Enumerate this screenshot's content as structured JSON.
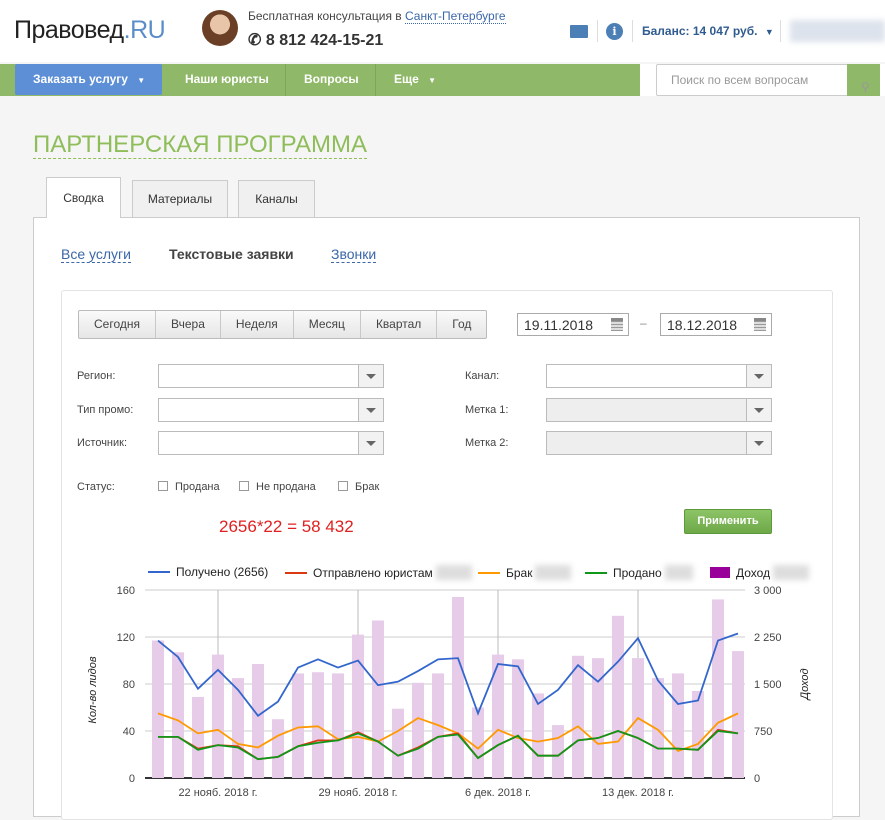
{
  "header": {
    "logo_main": "Правовед",
    "logo_suffix": ".RU",
    "consult_text": "Бесплатная консультация в ",
    "city": "Санкт-Петербурге",
    "phone": "8 812 424-15-21",
    "balance": "Баланс: 14 047 руб.",
    "info": "i"
  },
  "nav": {
    "order": "Заказать услугу",
    "items": [
      "Наши юристы",
      "Вопросы",
      "Еще"
    ],
    "search_placeholder": "Поиск по всем вопросам"
  },
  "page": {
    "title": "ПАРТНЕРСКАЯ ПРОГРАММА",
    "tabs": [
      "Сводка",
      "Материалы",
      "Каналы"
    ],
    "subtabs": [
      "Все услуги",
      "Текстовые заявки",
      "Звонки"
    ]
  },
  "filters": {
    "periods": [
      "Сегодня",
      "Вчера",
      "Неделя",
      "Месяц",
      "Квартал",
      "Год"
    ],
    "date_from": "19.11.2018",
    "date_to": "18.12.2018",
    "dash": "–",
    "labels": {
      "region": "Регион:",
      "promo": "Тип промо:",
      "source": "Источник:",
      "channel": "Канал:",
      "tag1": "Метка 1:",
      "tag2": "Метка 2:",
      "status": "Статус:"
    },
    "statuses": [
      "Продана",
      "Не продана",
      "Брак"
    ],
    "apply": "Применить"
  },
  "formula": "2656*22 = 58 432",
  "chart_data": {
    "type": "line+bar",
    "legend": [
      "Получено (2656)",
      "Отправлено юристам",
      "Брак",
      "Продано",
      "Доход"
    ],
    "colors": {
      "received": "#3366cc",
      "sent": "#dc3912",
      "defect": "#ff9900",
      "sold": "#109618",
      "revenue": "#e6cce8",
      "revenue_legend": "#990099"
    },
    "ylabel": "Кол-во лидов",
    "y2label": "Доход",
    "ylim": [
      0,
      160
    ],
    "y2lim": [
      0,
      3000
    ],
    "yticks": [
      "0",
      "40",
      "80",
      "120",
      "160"
    ],
    "y2ticks": [
      "0",
      "750",
      "1 500",
      "2 250",
      "3 000"
    ],
    "xticks": [
      "22 нояб. 2018 г.",
      "29 нояб. 2018 г.",
      "6 дек. 2018 г.",
      "13 дек. 2018 г."
    ],
    "xtick_index": [
      3,
      10,
      17,
      24
    ],
    "received": [
      117,
      103,
      76,
      92,
      75,
      53,
      65,
      94,
      101,
      94,
      100,
      79,
      82,
      91,
      101,
      102,
      55,
      97,
      95,
      63,
      75,
      96,
      82,
      99,
      119,
      83,
      63,
      66,
      117,
      123
    ],
    "sent": [
      35,
      35,
      25,
      28,
      27,
      16,
      18,
      27,
      32,
      32,
      39,
      31,
      19,
      26,
      35,
      38,
      17,
      28,
      36,
      19,
      19,
      32,
      34,
      40,
      34,
      25,
      25,
      24,
      41,
      38
    ],
    "defect": [
      55,
      49,
      38,
      41,
      29,
      26,
      36,
      43,
      44,
      33,
      35,
      31,
      40,
      51,
      45,
      38,
      25,
      41,
      34,
      31,
      34,
      44,
      29,
      31,
      51,
      41,
      23,
      29,
      47,
      55
    ],
    "sold": [
      35,
      35,
      24,
      28,
      26,
      16,
      18,
      27,
      30,
      32,
      38,
      31,
      19,
      25,
      35,
      37,
      17,
      28,
      36,
      19,
      19,
      32,
      34,
      40,
      34,
      25,
      25,
      24,
      40,
      38
    ],
    "revenue": [
      2194,
      2006,
      1294,
      1969,
      1594,
      1819,
      938,
      1669,
      1688,
      1669,
      2288,
      2513,
      1106,
      1519,
      1669,
      2888,
      1125,
      1969,
      1894,
      1350,
      844,
      1950,
      1913,
      2588,
      1913,
      1594,
      1669,
      1388,
      2850,
      2025
    ]
  }
}
